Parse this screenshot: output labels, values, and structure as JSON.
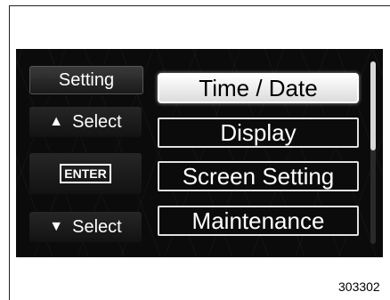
{
  "sidebar": {
    "title": "Setting",
    "up_label": "Select",
    "enter_label": "ENTER",
    "down_label": "Select",
    "up_icon": "triangle-up-icon",
    "down_icon": "triangle-down-icon"
  },
  "menu": {
    "items": [
      {
        "label": "Time / Date",
        "selected": true
      },
      {
        "label": "Display",
        "selected": false
      },
      {
        "label": "Screen Setting",
        "selected": false
      },
      {
        "label": "Maintenance",
        "selected": false
      }
    ]
  },
  "figure_id": "303302"
}
